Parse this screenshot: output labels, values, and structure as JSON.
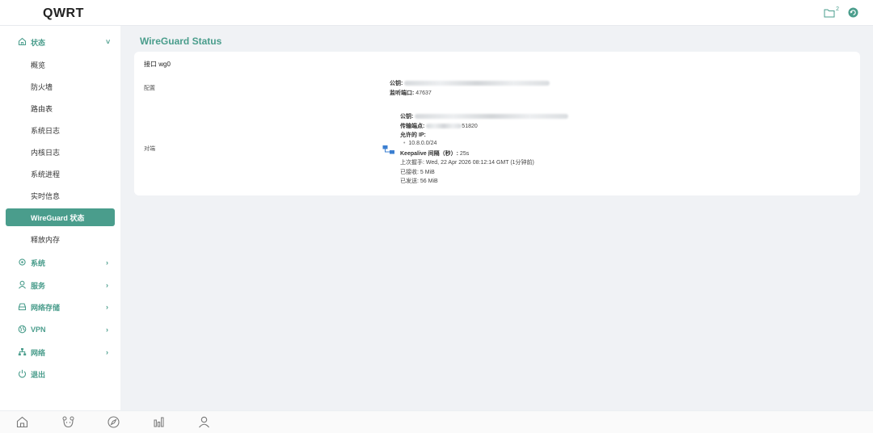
{
  "header": {
    "logo": "QWRT",
    "notice_count": "2"
  },
  "sidebar": {
    "groups": [
      {
        "label": "状态",
        "icon": "home-icon",
        "chevron": "˅"
      },
      {
        "label": "系统",
        "icon": "settings-icon",
        "chevron": "›"
      },
      {
        "label": "服务",
        "icon": "user-icon",
        "chevron": "›"
      },
      {
        "label": "网络存储",
        "icon": "storage-icon",
        "chevron": "›"
      },
      {
        "label": "VPN",
        "icon": "globe-icon",
        "chevron": "›"
      },
      {
        "label": "网络",
        "icon": "network-icon",
        "chevron": "›"
      },
      {
        "label": "退出",
        "icon": "power-icon"
      }
    ],
    "status_items": [
      "概览",
      "防火墙",
      "路由表",
      "系统日志",
      "内核日志",
      "系统进程",
      "实时信息",
      "WireGuard 状态",
      "释放内存"
    ],
    "active_item": "WireGuard 状态"
  },
  "main": {
    "title": "WireGuard Status",
    "interface_label": "接口 wg0",
    "config": {
      "label": "配置",
      "public_key_label": "公钥:",
      "listen_port_label": "监听端口:",
      "listen_port": "47637"
    },
    "peer": {
      "label": "对端",
      "public_key_label": "公钥:",
      "endpoint_label": "传输端点:",
      "endpoint_suffix": "51820",
      "allowed_ips_label": "允许的 IP:",
      "allowed_ips": [
        "10.8.0.0/24"
      ],
      "keepalive_label": "Keepalive 间隔（秒）:",
      "keepalive": "25s",
      "handshake_label": "上次握手:",
      "handshake": "Wed, 22 Apr 2026 08:12:14 GMT (1分钟前)",
      "received_label": "已接收:",
      "received": "5 MiB",
      "sent_label": "已发送:",
      "sent": "56 MiB"
    }
  },
  "colors": {
    "accent": "#4a9d8c",
    "background": "#f0f2f5"
  },
  "bottombar": {
    "icons": [
      "home-icon",
      "bear-icon",
      "compass-icon",
      "chart-icon",
      "user-icon"
    ]
  }
}
